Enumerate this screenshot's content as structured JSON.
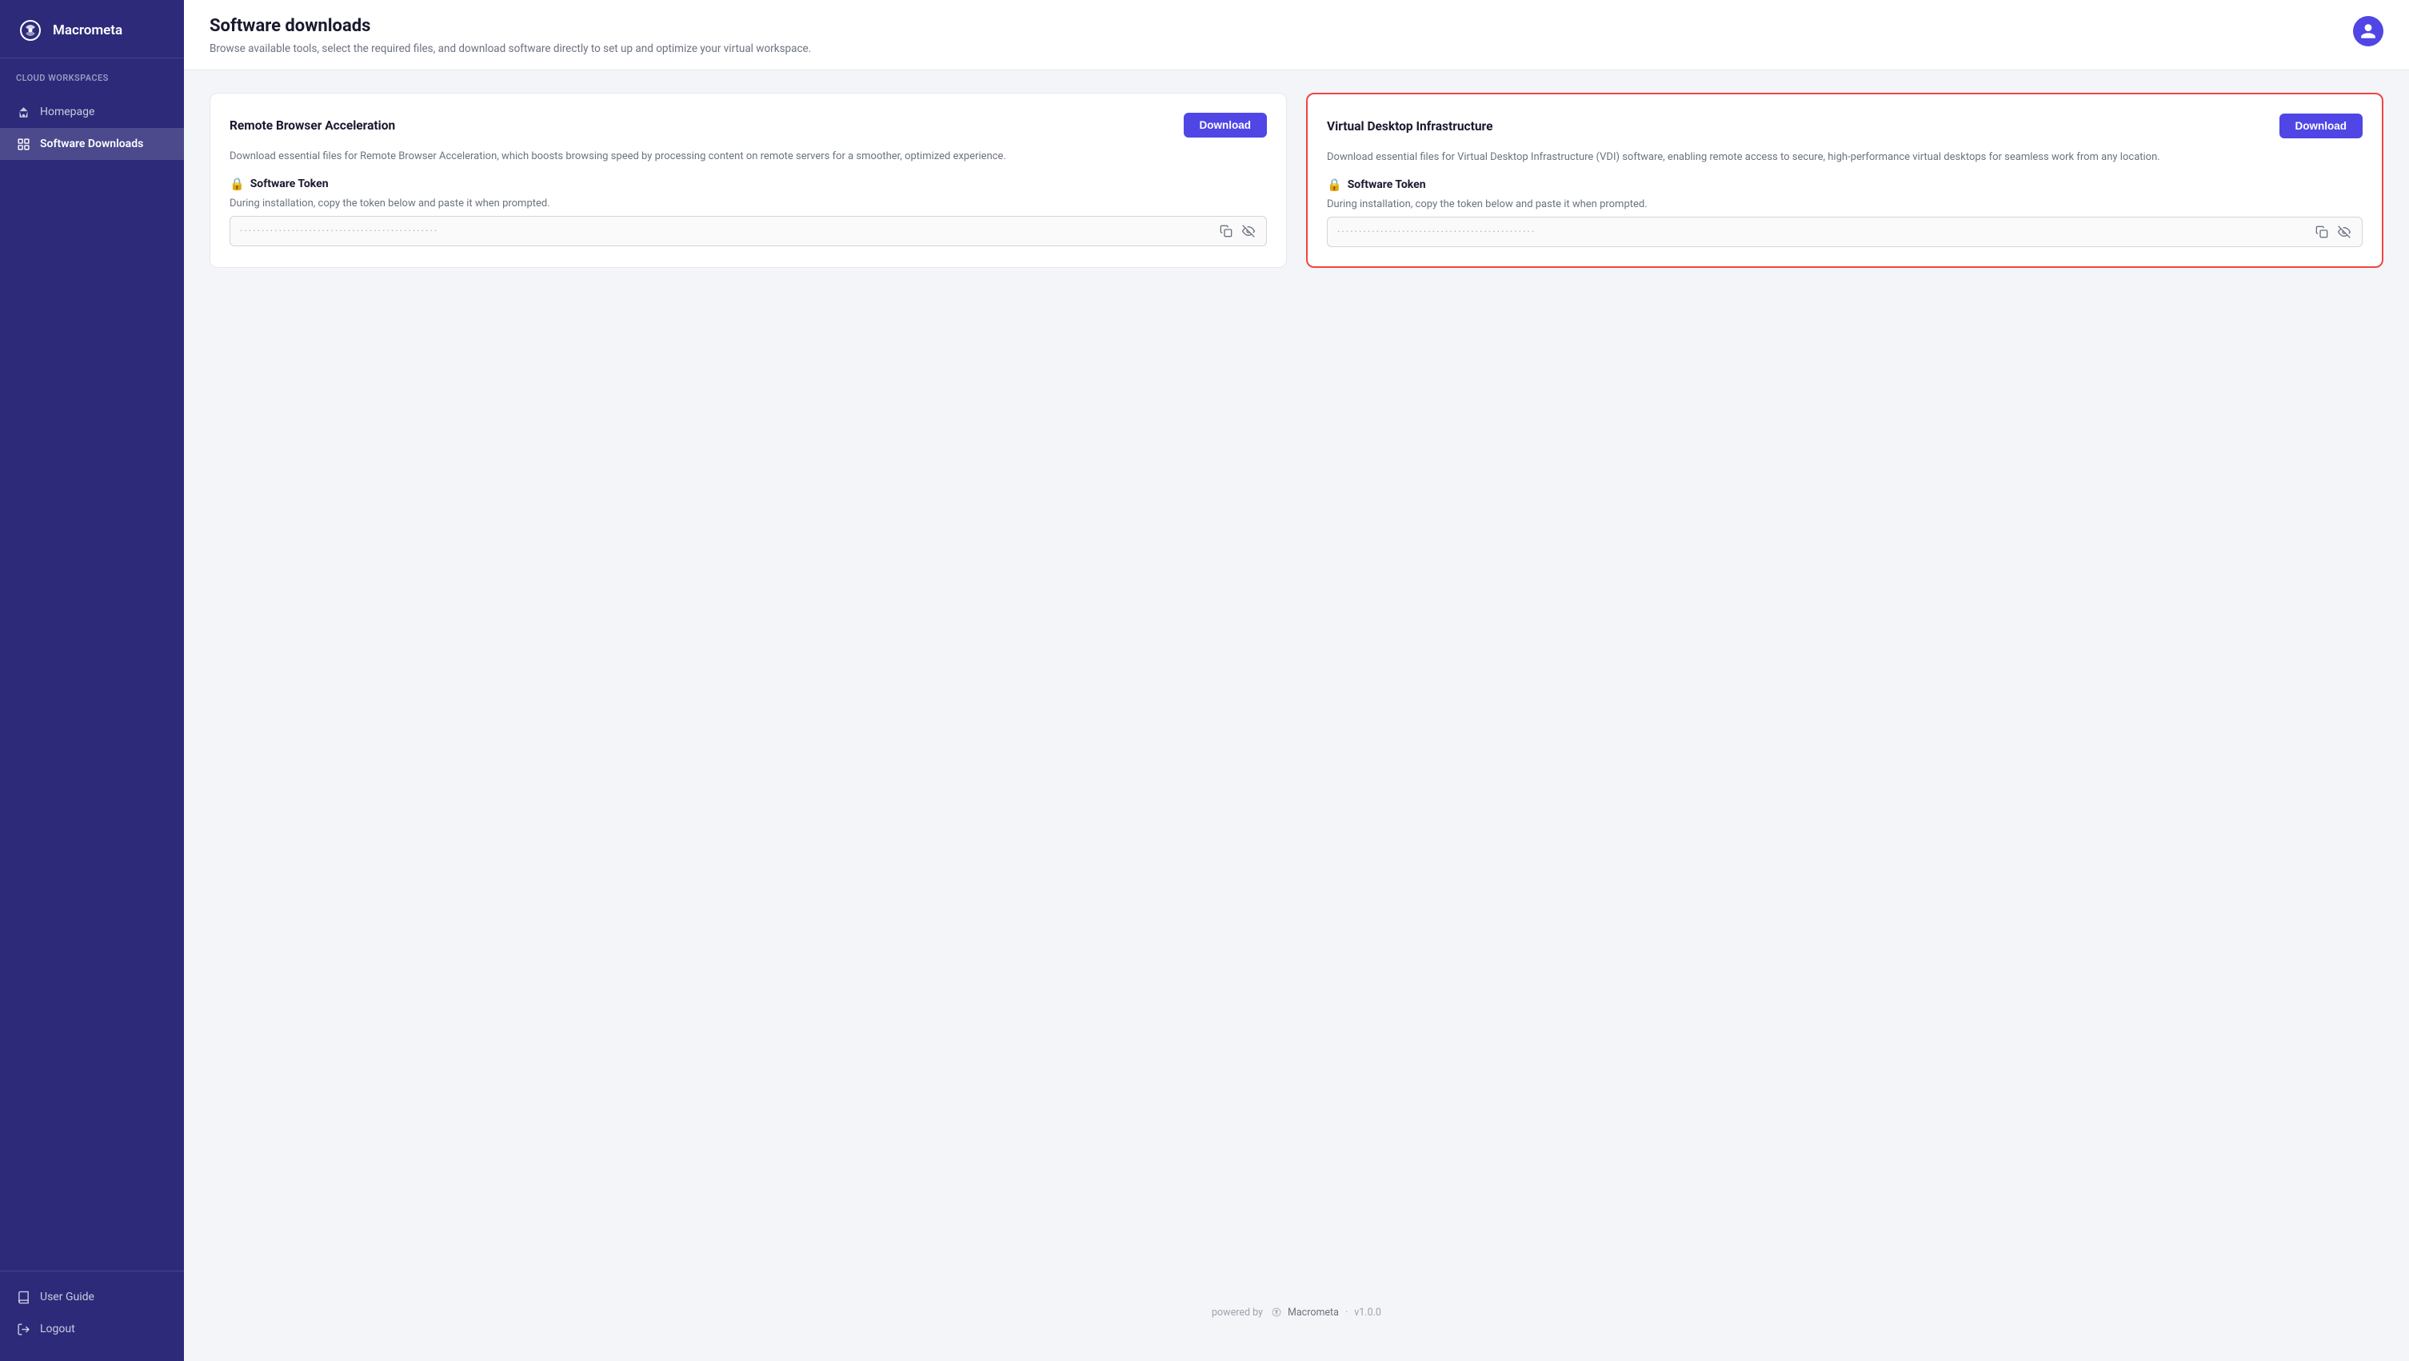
{
  "sidebar": {
    "logo_text": "Macrometa",
    "section_label": "Cloud Workspaces",
    "nav_items": [
      {
        "id": "homepage",
        "label": "Homepage",
        "icon": "home-icon",
        "active": false
      },
      {
        "id": "software-downloads",
        "label": "Software Downloads",
        "icon": "download-icon",
        "active": true
      }
    ],
    "bottom_items": [
      {
        "id": "user-guide",
        "label": "User Guide",
        "icon": "book-icon"
      },
      {
        "id": "logout",
        "label": "Logout",
        "icon": "logout-icon"
      }
    ]
  },
  "header": {
    "title": "Software downloads",
    "subtitle": "Browse available tools, select the required files, and download software directly to set up and optimize your virtual workspace."
  },
  "cards": [
    {
      "id": "rba",
      "title": "Remote Browser Acceleration",
      "download_label": "Download",
      "description": "Download essential files for Remote Browser Acceleration, which boosts browsing speed by processing content on remote servers for a smoother, optimized experience.",
      "token_label": "Software Token",
      "token_hint": "During installation, copy the token below and paste it when prompted.",
      "token_placeholder": "·····················································",
      "highlighted": false
    },
    {
      "id": "vdi",
      "title": "Virtual Desktop Infrastructure",
      "download_label": "Download",
      "description": "Download essential files for Virtual Desktop Infrastructure (VDI) software, enabling remote access to secure, high-performance virtual desktops for seamless work from any location.",
      "token_label": "Software Token",
      "token_hint": "During installation, copy the token below and paste it when prompted.",
      "token_placeholder": "·····················································",
      "highlighted": true
    }
  ],
  "footer": {
    "powered_by": "powered by",
    "logo_text": "Macrometa",
    "version": "v1.0.0"
  }
}
